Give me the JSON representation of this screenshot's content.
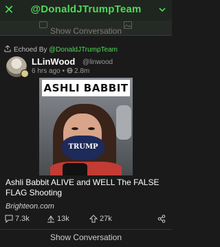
{
  "header": {
    "title": "@DonaldJTrumpTeam",
    "close_icon": "close-icon",
    "menu_icon": "chevron-down-icon",
    "accent_color": "#4fd95a"
  },
  "tabstrip": {
    "faded_label": "Show Conversation"
  },
  "echo": {
    "prefix": "Echoed By",
    "handle": "@DonaldJTrumpTeam"
  },
  "post": {
    "author_name": "LLinWood",
    "author_handle": "@linwood",
    "time": "6 hrs ago",
    "views": "2.8m",
    "image_caption": "ASHLI BABBIT",
    "mask_text": "TRUMP",
    "text": "Ashli Babbit ALIVE and WELL The FALSE FLAG Shooting",
    "link": "Brighteon.com"
  },
  "actions": {
    "replies": "7.3k",
    "echoes": "13k",
    "upvotes": "27k"
  },
  "footer": {
    "show_conversation": "Show Conversation"
  }
}
